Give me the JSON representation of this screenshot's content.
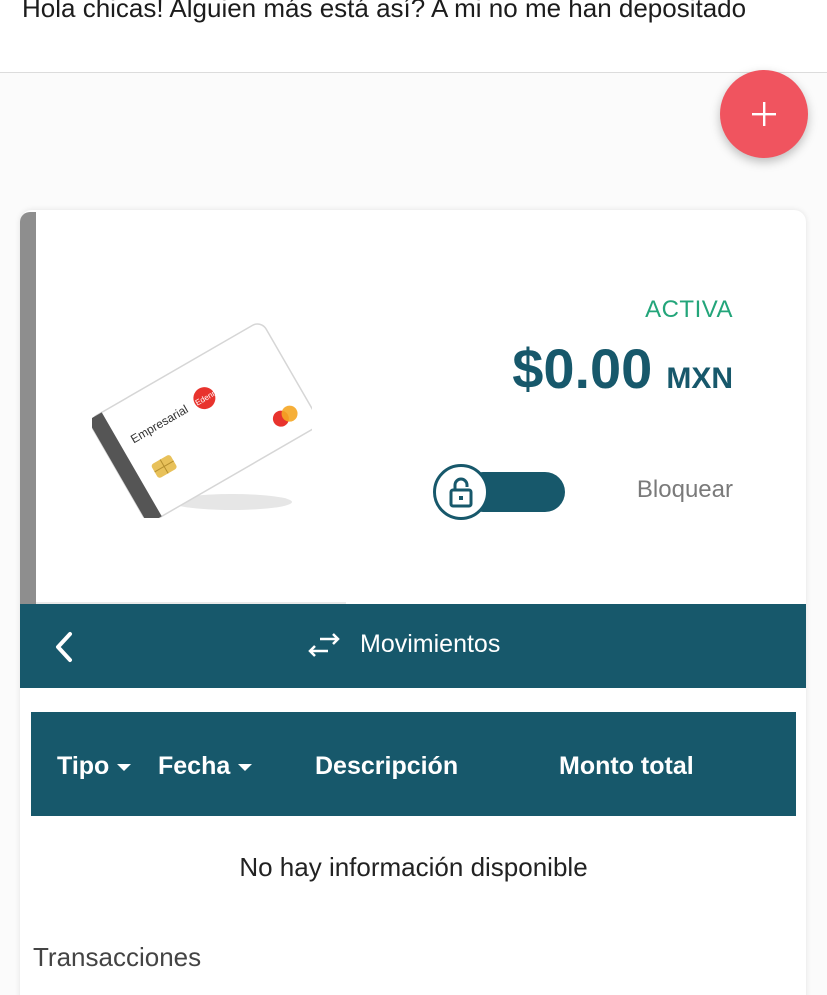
{
  "post": {
    "text": "Hola chicas! Alguien más está así? A mi no me han depositado"
  },
  "fab": {
    "icon": "plus-icon",
    "color": "#f0545f"
  },
  "card": {
    "status": "ACTIVA",
    "balance_amount": "$0.00",
    "balance_currency": "MXN",
    "card_image": {
      "brand_text": "Empresarial",
      "logo_text": "Edenred",
      "network_icon": "mastercard-icon"
    },
    "lock": {
      "icon": "lock-icon",
      "label": "Bloquear"
    }
  },
  "movements": {
    "back_icon": "chevron-left-icon",
    "icon": "swap-arrows-icon",
    "title": "Movimientos"
  },
  "table": {
    "columns": [
      {
        "label": "Tipo",
        "sortable": true
      },
      {
        "label": "Fecha",
        "sortable": true
      },
      {
        "label": "Descripción",
        "sortable": false
      },
      {
        "label": "Monto total",
        "sortable": false
      }
    ],
    "empty_message": "No hay información disponible"
  },
  "section_label": "Transacciones",
  "colors": {
    "primary": "#17586b",
    "active": "#23a57a",
    "accent": "#f0545f"
  }
}
